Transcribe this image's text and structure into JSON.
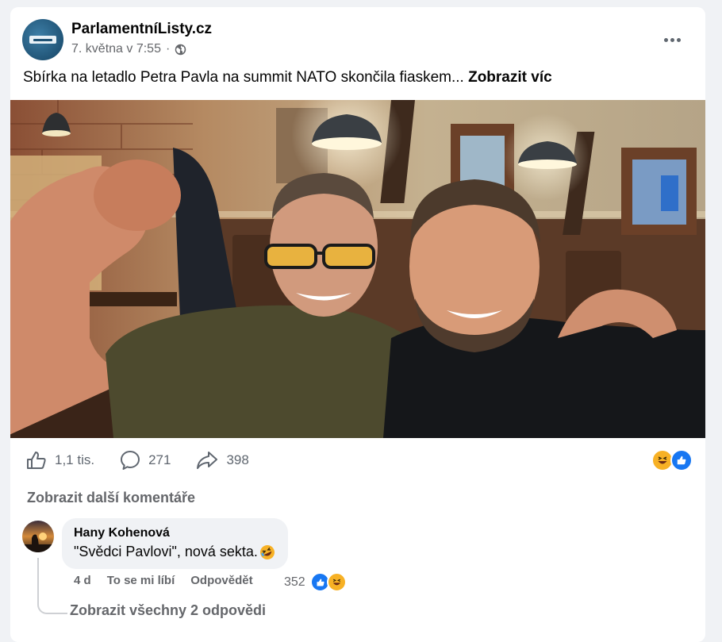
{
  "post": {
    "page_name": "ParlamentníListy.cz",
    "timestamp": "7. května v 7:55",
    "separator": "·",
    "audience_icon": "globe-icon",
    "text": "Sbírka na letadlo Petra Pavla na summit NATO skončila fiaskem... ",
    "see_more": "Zobrazit víc"
  },
  "actions": {
    "like_count": "1,1 tis.",
    "comment_count": "271",
    "share_count": "398",
    "reactions": [
      "haha-icon",
      "like-icon"
    ]
  },
  "comments": {
    "more_label": "Zobrazit další komentáře",
    "items": [
      {
        "author": "Hany Kohenová",
        "text": "\"Svědci Pavlovi\", nová sekta.",
        "emoji": "rolling-laughing-icon",
        "age": "4 d",
        "like_label": "To se mi líbí",
        "reply_label": "Odpovědět",
        "reaction_count": "352",
        "reactions": [
          "like-icon",
          "haha-icon"
        ]
      }
    ],
    "view_replies": "Zobrazit všechny 2 odpovědi"
  },
  "colors": {
    "like_blue": "#1877f2",
    "haha_yellow": "#f7b125",
    "secondary_text": "#65676b",
    "page_background": "#f0f2f5"
  }
}
